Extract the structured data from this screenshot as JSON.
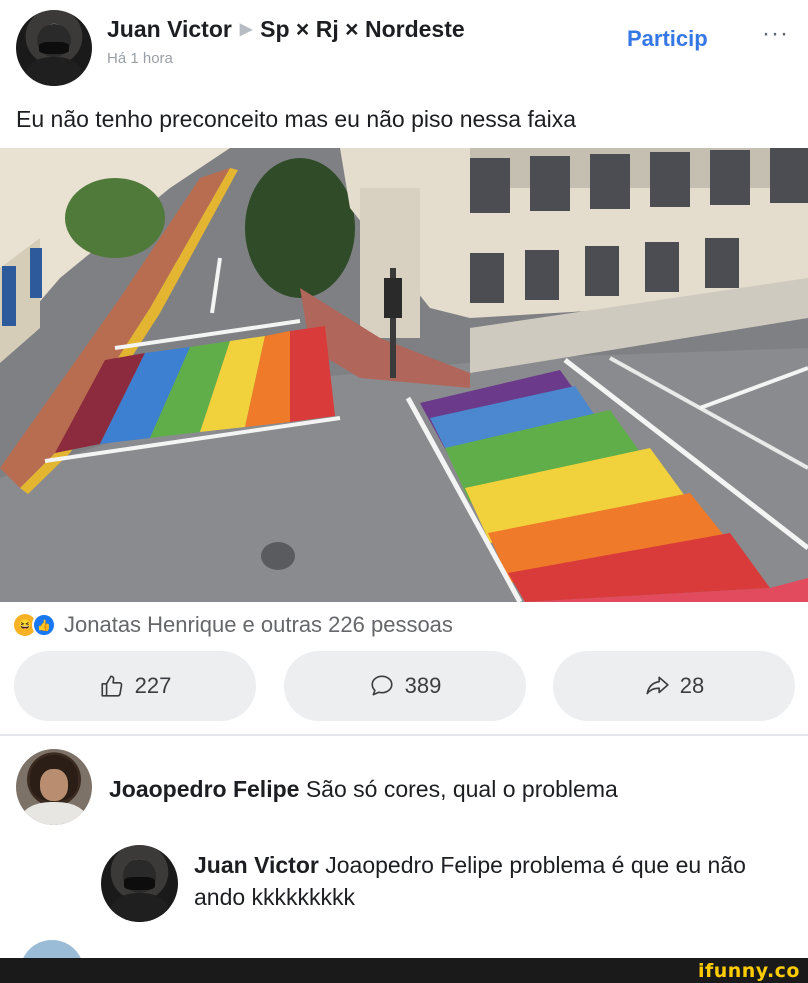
{
  "header": {
    "author": "Juan Victor",
    "group": "Sp × Rj × Nordeste",
    "time": "Há 1 hora",
    "join_label": "Particip",
    "more_label": "···"
  },
  "post": {
    "text": "Eu não tenho preconceito mas eu não piso nessa faixa"
  },
  "photo": {
    "stripe_colors": [
      "#d93a3a",
      "#ef7a2a",
      "#f2d23c",
      "#5fae4a",
      "#3d7fd0",
      "#7a3b8c"
    ]
  },
  "reactions": {
    "icons": [
      "haha-icon",
      "like-icon"
    ],
    "text": "Jonatas Henrique e outras 226 pessoas"
  },
  "actions": {
    "like_count": "227",
    "comment_count": "389",
    "share_count": "28"
  },
  "comments": [
    {
      "author": "Joaopedro Felipe",
      "text": "São só cores, qual o problema"
    },
    {
      "author": "Juan Victor",
      "text": "Joaopedro Felipe problema é que eu não ando kkkkkkkkk"
    }
  ],
  "watermark": "ifunny.co",
  "colors": {
    "accent": "#3578e5",
    "pill": "#edeef0",
    "watermark": "#ffcc00"
  }
}
